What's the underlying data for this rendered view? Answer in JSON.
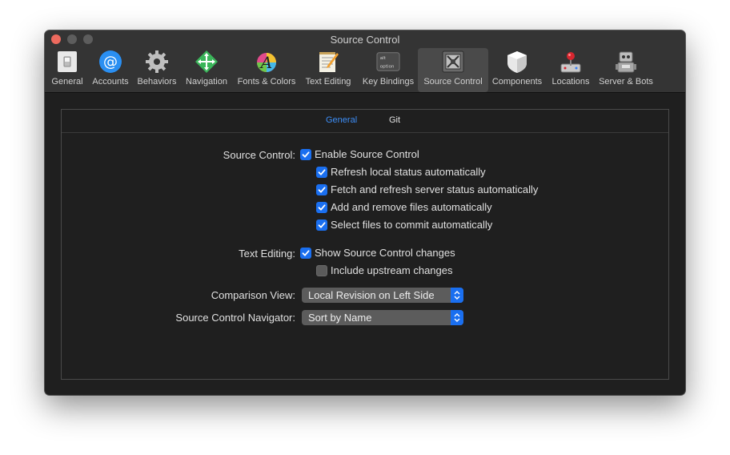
{
  "window": {
    "title": "Source Control"
  },
  "toolbar": {
    "items": [
      {
        "label": "General",
        "icon": "switch-icon"
      },
      {
        "label": "Accounts",
        "icon": "at-sign-icon"
      },
      {
        "label": "Behaviors",
        "icon": "gear-icon"
      },
      {
        "label": "Navigation",
        "icon": "navigation-arrows-icon"
      },
      {
        "label": "Fonts & Colors",
        "icon": "font-color-icon"
      },
      {
        "label": "Text Editing",
        "icon": "notepad-pencil-icon"
      },
      {
        "label": "Key Bindings",
        "icon": "option-key-icon",
        "key_text": "alt",
        "key_text2": "option"
      },
      {
        "label": "Source Control",
        "icon": "source-control-icon",
        "selected": true
      },
      {
        "label": "Components",
        "icon": "shield-box-icon"
      },
      {
        "label": "Locations",
        "icon": "joystick-icon"
      },
      {
        "label": "Server & Bots",
        "icon": "robot-icon"
      }
    ]
  },
  "tabs": {
    "general": "General",
    "git": "Git",
    "selected": "General"
  },
  "source_control": {
    "label": "Source Control:",
    "enable": {
      "label": "Enable Source Control",
      "checked": true
    },
    "refresh_local": {
      "label": "Refresh local status automatically",
      "checked": true
    },
    "fetch_refresh": {
      "label": "Fetch and refresh server status automatically",
      "checked": true
    },
    "add_remove": {
      "label": "Add and remove files automatically",
      "checked": true
    },
    "select_files": {
      "label": "Select files to commit automatically",
      "checked": true
    }
  },
  "text_editing": {
    "label": "Text Editing:",
    "show_changes": {
      "label": "Show Source Control changes",
      "checked": true
    },
    "include_upstream": {
      "label": "Include upstream changes",
      "checked": false
    }
  },
  "comparison_view": {
    "label": "Comparison View:",
    "value": "Local Revision on Left Side"
  },
  "navigator": {
    "label": "Source Control Navigator:",
    "value": "Sort by Name"
  },
  "colors": {
    "accent": "#1a6ff0",
    "tab_selected": "#3d8ef7",
    "close": "#ed6a5e"
  }
}
